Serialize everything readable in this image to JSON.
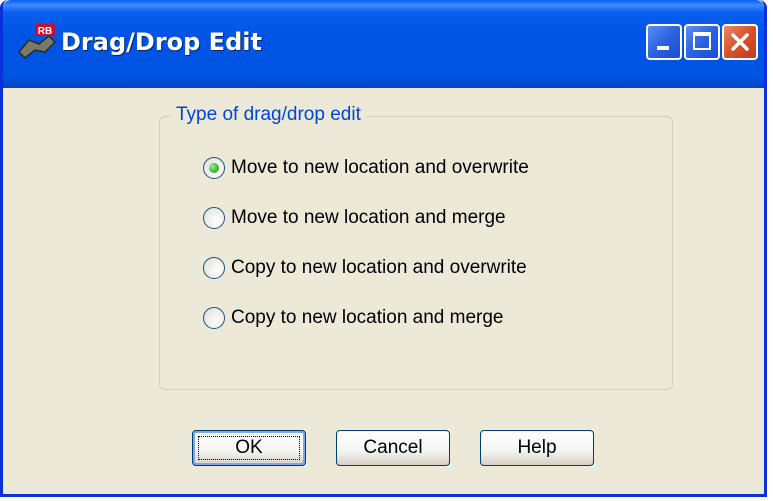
{
  "window": {
    "title": "Drag/Drop Edit",
    "app_icon": "rb-app-icon",
    "controls": [
      "minimize-icon",
      "maximize-icon",
      "close-icon"
    ]
  },
  "group": {
    "label": "Type of drag/drop edit",
    "options": [
      {
        "label": "Move to new location and overwrite",
        "selected": true
      },
      {
        "label": "Move to new location and merge",
        "selected": false
      },
      {
        "label": "Copy to new location and overwrite",
        "selected": false
      },
      {
        "label": "Copy to new location and merge",
        "selected": false
      }
    ]
  },
  "buttons": {
    "ok": "OK",
    "cancel": "Cancel",
    "help": "Help"
  },
  "colors": {
    "titlebar": "#0054e3",
    "dialog_bg": "#ece9d8",
    "group_label": "#0046d5",
    "close_button": "#d6512c",
    "radio_selected": "#21a121"
  }
}
